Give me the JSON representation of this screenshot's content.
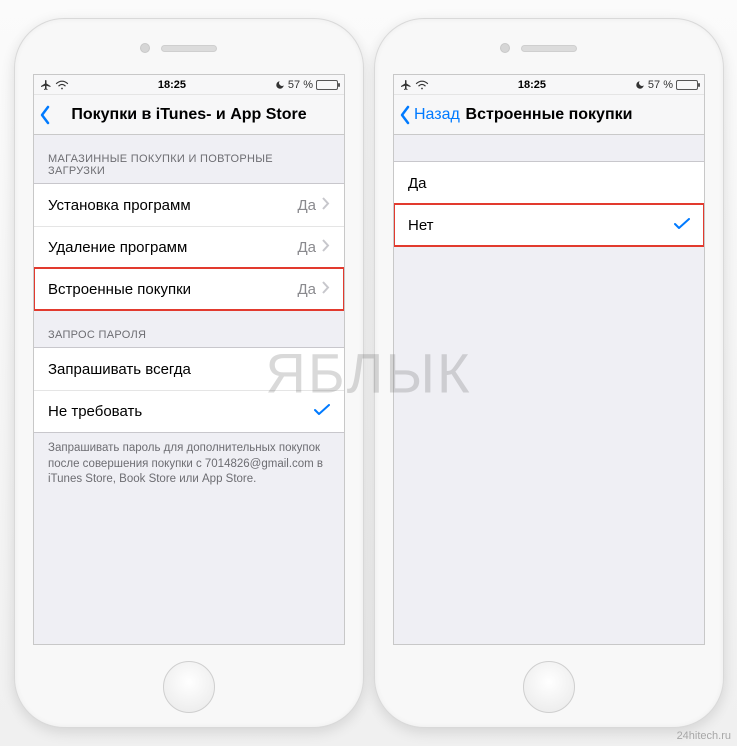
{
  "status": {
    "time": "18:25",
    "battery_pct": "57 %"
  },
  "left": {
    "nav": {
      "title": "Покупки в iTunes- и App Store",
      "back": ""
    },
    "section1_header": "МАГАЗИННЫЕ ПОКУПКИ И ПОВТОРНЫЕ ЗАГРУЗКИ",
    "rows1": [
      {
        "label": "Установка программ",
        "value": "Да"
      },
      {
        "label": "Удаление программ",
        "value": "Да"
      },
      {
        "label": "Встроенные покупки",
        "value": "Да"
      }
    ],
    "section2_header": "ЗАПРОС ПАРОЛЯ",
    "rows2": [
      {
        "label": "Запрашивать всегда",
        "selected": false
      },
      {
        "label": "Не требовать",
        "selected": true
      }
    ],
    "footer": "Запрашивать пароль для дополнительных покупок после совершения покупки с 7014826@gmail.com в iTunes Store, Book Store или App Store."
  },
  "right": {
    "nav": {
      "title": "Встроенные покупки",
      "back": "Назад"
    },
    "rows": [
      {
        "label": "Да",
        "selected": false
      },
      {
        "label": "Нет",
        "selected": true
      }
    ]
  },
  "watermark": "ЯБЛЫК",
  "credit": "24hitech.ru"
}
